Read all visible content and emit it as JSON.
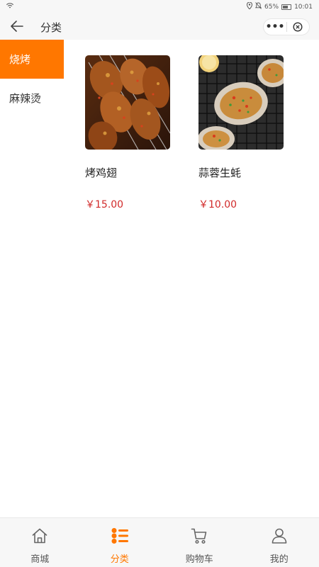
{
  "status_bar": {
    "wifi_icon": "wifi-icon",
    "battery_percent": "65%",
    "time": "10:01"
  },
  "header": {
    "title": "分类",
    "more_label": "•••"
  },
  "sidebar": {
    "items": [
      {
        "label": "烧烤",
        "active": true
      },
      {
        "label": "麻辣烫",
        "active": false
      }
    ]
  },
  "products": [
    {
      "name": "烤鸡翅",
      "price": "￥15.00",
      "image": "grilled-chicken-wings-skewers"
    },
    {
      "name": "蒜蓉生蚝",
      "price": "￥10.00",
      "image": "garlic-oysters-on-grill"
    }
  ],
  "tabbar": {
    "items": [
      {
        "label": "商城",
        "icon": "home-icon",
        "active": false
      },
      {
        "label": "分类",
        "icon": "category-icon",
        "active": true
      },
      {
        "label": "购物车",
        "icon": "cart-icon",
        "active": false
      },
      {
        "label": "我的",
        "icon": "user-icon",
        "active": false
      }
    ]
  },
  "colors": {
    "accent": "#ff7700",
    "price": "#d12a2a"
  }
}
